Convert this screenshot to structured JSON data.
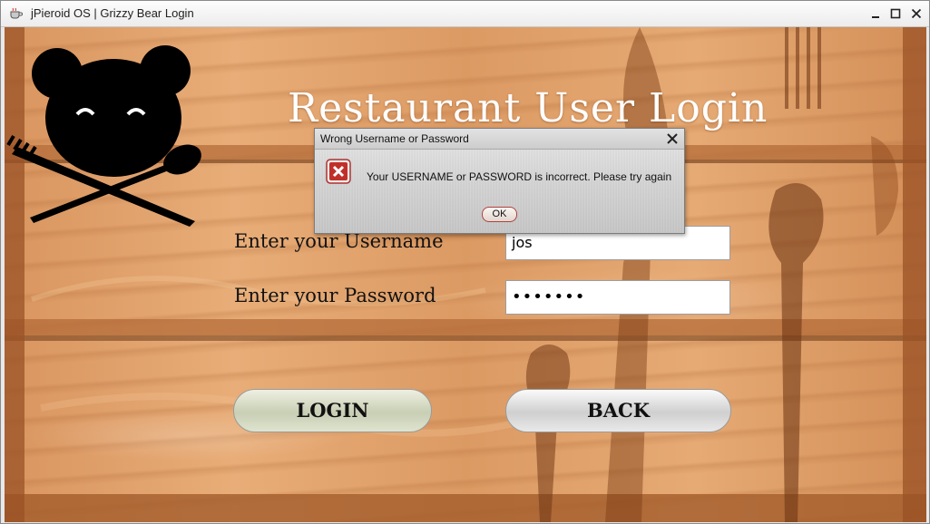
{
  "window": {
    "title": "jPieroid OS | Grizzy Bear Login",
    "icon": "coffee-cup-icon",
    "controls": [
      "minimize-icon",
      "maximize-icon",
      "close-icon"
    ]
  },
  "page": {
    "title": "Restaurant User Login",
    "logo": "bear-fork-spoon-logo"
  },
  "form": {
    "username_label": "Enter your Username",
    "username_value": "jos",
    "password_label": "Enter your Password",
    "password_value": "•••••••",
    "login_label": "LOGIN",
    "back_label": "BACK"
  },
  "dialog": {
    "title": "Wrong Username or Password",
    "message": "Your USERNAME or PASSWORD is incorrect. Please try again",
    "ok_label": "OK",
    "icon": "error-icon"
  },
  "colors": {
    "wood": "#e0a06a",
    "wood_dark": "#8a4a1e",
    "title_text": "#ffffff"
  }
}
